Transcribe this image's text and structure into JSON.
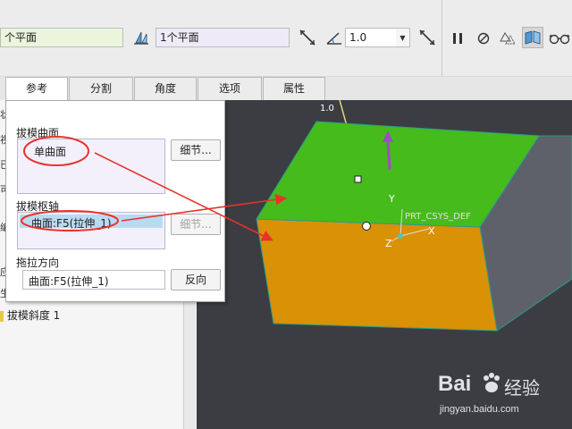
{
  "dashboard": {
    "surface_field": "个平面",
    "hinge_field": "1个平面",
    "angle_value": "1.0",
    "icons": [
      "flip-direction-icon",
      "angle-flip-icon",
      "angle-icon",
      "flip-angle-icon",
      "pause-icon",
      "stop-icon",
      "preview-icon",
      "verify-icon",
      "glasses-icon"
    ]
  },
  "tabs": [
    "参考",
    "分割",
    "角度",
    "选项",
    "属性"
  ],
  "panel": {
    "draft_surfaces_label": "拔模曲面",
    "draft_surfaces_item": "单曲面",
    "details_button": "细节...",
    "draft_hinges_label": "拔模枢轴",
    "draft_hinges_item": "曲面:F5(拉伸_1)",
    "hinge_details_button": "细节...",
    "pull_direction_label": "拖拉方向",
    "pull_direction_value": "曲面:F5(拉伸_1)",
    "flip_button": "反向"
  },
  "tree": {
    "fragments": [
      "状",
      "视",
      "已",
      "可",
      "编",
      "应",
      "生"
    ],
    "draft_item": "拔模斜度 1"
  },
  "viewport": {
    "angle_label": "1.0",
    "csys_label": "PRT_CSYS_DEF",
    "axis_y": "Y",
    "axis_z": "Z",
    "axis_x": "X",
    "colors": {
      "top_face": "#46bb1c",
      "front_face": "#d99105",
      "side_face": "#5e6169",
      "background": "#3b3d42",
      "arrow": "#e8322c",
      "drag_handle": "#a04cc4"
    }
  },
  "watermark": {
    "brand_left": "Bai",
    "brand_right": "经验",
    "url": "jingyan.baidu.com"
  }
}
